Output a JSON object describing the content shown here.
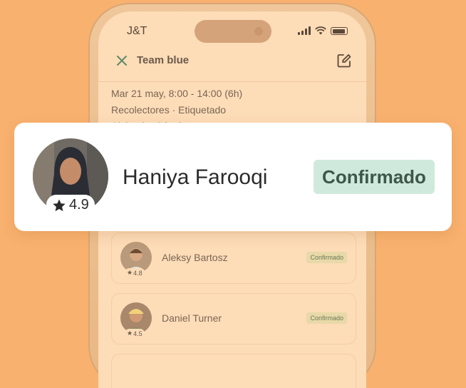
{
  "status_bar": {
    "carrier": "J&T"
  },
  "header": {
    "title": "Team blue"
  },
  "shift": {
    "time": "Mar 21 may, 8:00 - 14:00 (6h)",
    "roles": "Recolectores · Etiquetado",
    "partial": "Alejandro Sánchez"
  },
  "featured": {
    "name": "Haniya Farooqi",
    "rating": "4.9",
    "status": "Confirmado"
  },
  "members": [
    {
      "name": "Aleksy Bartosz",
      "rating": "4.8",
      "status": "Confirmado"
    },
    {
      "name": "Daniel Turner",
      "rating": "4.5",
      "status": "Confirmado"
    }
  ],
  "colors": {
    "background": "#f9b16f",
    "screen": "#fddcb8",
    "confirmed_badge": "#cfeadc",
    "confirmed_text": "#3f574b"
  },
  "icons": [
    "close-icon",
    "edit-icon",
    "signal-icon",
    "wifi-icon",
    "battery-icon",
    "star-icon"
  ]
}
